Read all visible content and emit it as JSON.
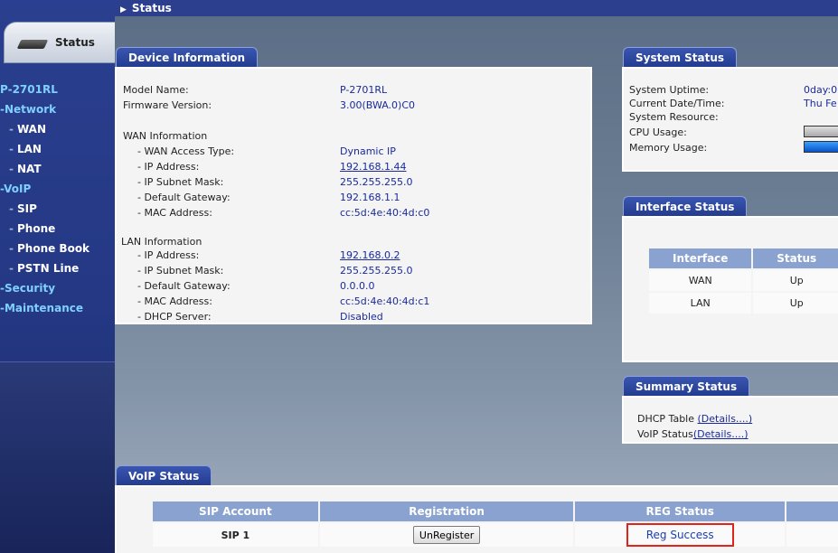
{
  "topbar": {
    "title": "Status"
  },
  "sidebar": {
    "status_tab": "Status",
    "items": [
      {
        "label": "P-2701RL",
        "type": "top"
      },
      {
        "label": "Network",
        "type": "top"
      },
      {
        "label": "WAN",
        "type": "sub"
      },
      {
        "label": "LAN",
        "type": "sub"
      },
      {
        "label": "NAT",
        "type": "sub"
      },
      {
        "label": "VoIP",
        "type": "top"
      },
      {
        "label": "SIP",
        "type": "sub"
      },
      {
        "label": "Phone",
        "type": "sub"
      },
      {
        "label": "Phone Book",
        "type": "sub"
      },
      {
        "label": "PSTN Line",
        "type": "sub"
      },
      {
        "label": "Security",
        "type": "top"
      },
      {
        "label": "Maintenance",
        "type": "top"
      }
    ]
  },
  "device": {
    "title": "Device Information",
    "model_label": "Model Name:",
    "model_value": "P-2701RL",
    "firmware_label": "Firmware Version:",
    "firmware_value": "3.00(BWA.0)C0",
    "wan_heading": "WAN Information",
    "wan_access_label": "- WAN Access Type:",
    "wan_access_value": "Dynamic IP",
    "wan_ip_label": "- IP Address:",
    "wan_ip_value": "192.168.1.44",
    "wan_mask_label": "- IP Subnet Mask:",
    "wan_mask_value": "255.255.255.0",
    "wan_gw_label": "- Default Gateway:",
    "wan_gw_value": "192.168.1.1",
    "wan_mac_label": "- MAC Address:",
    "wan_mac_value": "cc:5d:4e:40:4d:c0",
    "lan_heading": "LAN Information",
    "lan_ip_label": "- IP Address:",
    "lan_ip_value": "192.168.0.2",
    "lan_mask_label": "- IP Subnet Mask:",
    "lan_mask_value": "255.255.255.0",
    "lan_gw_label": "- Default Gateway:",
    "lan_gw_value": "0.0.0.0",
    "lan_mac_label": "- MAC Address:",
    "lan_mac_value": "cc:5d:4e:40:4d:c1",
    "dhcp_label": "- DHCP Server:",
    "dhcp_value": "Disabled"
  },
  "system": {
    "title": "System Status",
    "uptime_label": "System Uptime:",
    "uptime_value": "0day:0",
    "datetime_label": "Current Date/Time:",
    "datetime_value": "Thu Fe",
    "resource_label": "System Resource:",
    "cpu_label": "CPU Usage:",
    "memory_label": "Memory Usage:"
  },
  "interface": {
    "title": "Interface Status",
    "headers": [
      "Interface",
      "Status"
    ],
    "rows": [
      {
        "name": "WAN",
        "status": "Up"
      },
      {
        "name": "LAN",
        "status": "Up"
      }
    ]
  },
  "summary": {
    "title": "Summary Status",
    "dhcp_label": "DHCP Table ",
    "dhcp_link": "(Details....)",
    "voip_label": "VoIP Status",
    "voip_link": "(Details....)"
  },
  "voip": {
    "title": "VoIP Status",
    "headers": [
      "SIP Account",
      "Registration",
      "REG Status"
    ],
    "row": {
      "account": "SIP 1",
      "button": "UnRegister",
      "status": "Reg Success"
    }
  },
  "colors": {
    "sidebar_bg": "#243884",
    "link": "#1a2a9c",
    "table_header": "#8aa2cf",
    "highlight_border": "#e0241c"
  }
}
